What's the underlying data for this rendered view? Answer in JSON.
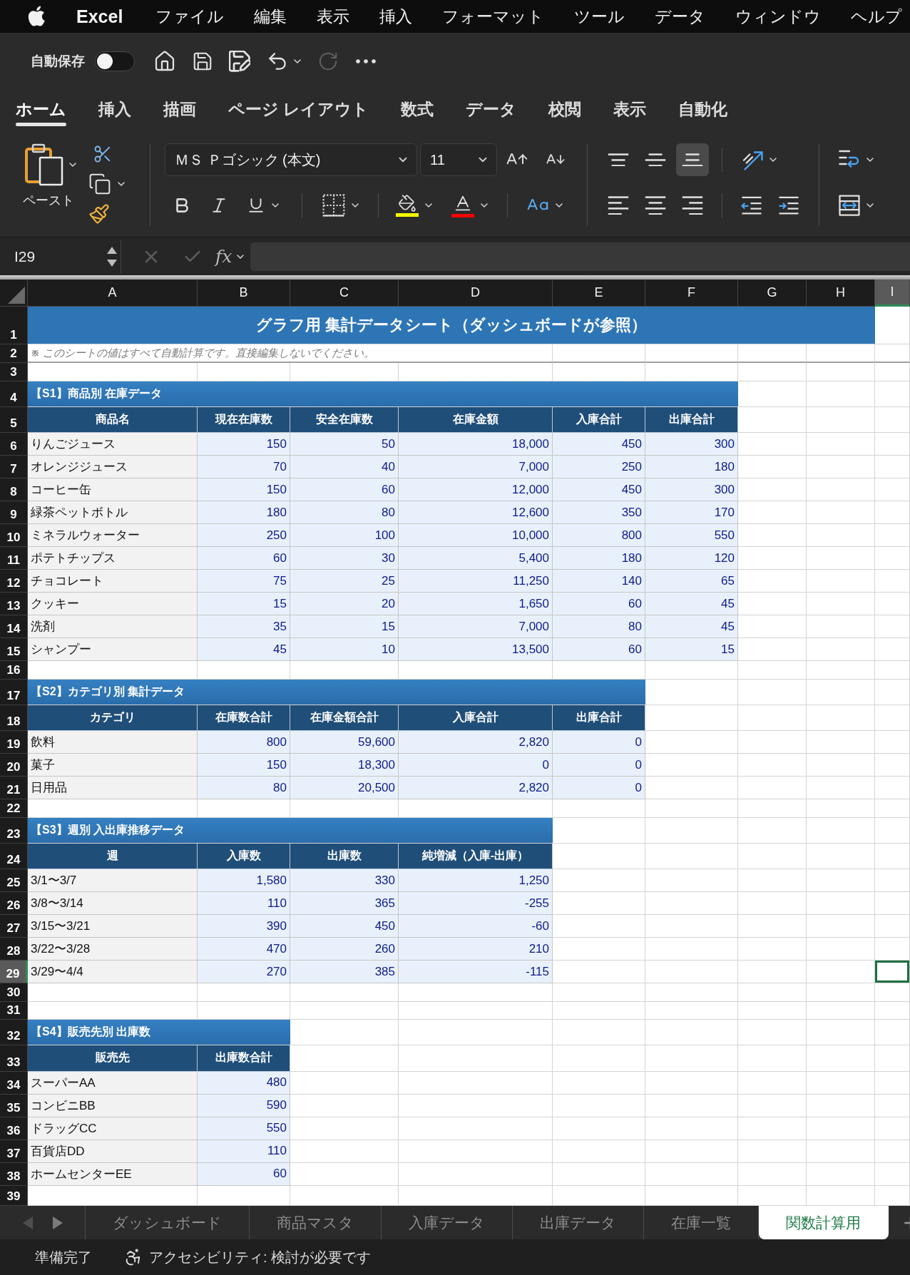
{
  "menu_bar": {
    "app_name": "Excel",
    "items": [
      "ファイル",
      "編集",
      "表示",
      "挿入",
      "フォーマット",
      "ツール",
      "データ",
      "ウィンドウ",
      "ヘルプ"
    ]
  },
  "quick_access": {
    "autosave_label": "自動保存",
    "autosave_on": false,
    "redo_disabled": true
  },
  "ribbon_tabs": [
    {
      "label": "ホーム",
      "selected": true
    },
    {
      "label": "挿入",
      "selected": false
    },
    {
      "label": "描画",
      "selected": false
    },
    {
      "label": "ページ レイアウト",
      "selected": false
    },
    {
      "label": "数式",
      "selected": false
    },
    {
      "label": "データ",
      "selected": false
    },
    {
      "label": "校閲",
      "selected": false
    },
    {
      "label": "表示",
      "selected": false
    },
    {
      "label": "自動化",
      "selected": false
    }
  ],
  "ribbon": {
    "paste_label": "ペースト",
    "font_name": "ＭＳ Ｐゴシック (本文)",
    "font_size": "11",
    "vertical_align": [
      {
        "kind": "top",
        "selected": false
      },
      {
        "kind": "middle",
        "selected": false
      },
      {
        "kind": "bottom",
        "selected": true
      }
    ]
  },
  "formula_bar": {
    "name_box": "I29",
    "function_label": "fx"
  },
  "column_headers": [
    {
      "label": "A",
      "selected": false
    },
    {
      "label": "B",
      "selected": false
    },
    {
      "label": "C",
      "selected": false
    },
    {
      "label": "D",
      "selected": false
    },
    {
      "label": "E",
      "selected": false
    },
    {
      "label": "F",
      "selected": false
    },
    {
      "label": "G",
      "selected": false
    },
    {
      "label": "H",
      "selected": false
    },
    {
      "label": "I",
      "selected": true
    }
  ],
  "rows": [
    {
      "label": "1",
      "selected": false,
      "kind": "title",
      "text": "グラフ用 集計データシート（ダッシュボードが参照）"
    },
    {
      "label": "2",
      "selected": false,
      "kind": "note",
      "text": "※ このシートの値はすべて自動計算です。直接編集しないでください。"
    },
    {
      "label": "3",
      "selected": false,
      "kind": "empty"
    },
    {
      "label": "4",
      "selected": false,
      "kind": "section",
      "text": "【S1】商品別 在庫データ"
    },
    {
      "label": "5",
      "selected": false,
      "kind": "header",
      "cells": [
        "商品名",
        "現在在庫数",
        "安全在庫数",
        "在庫金額",
        "入庫合計",
        "出庫合計"
      ]
    },
    {
      "label": "6",
      "selected": false,
      "kind": "data",
      "cells": [
        "りんごジュース",
        "150",
        "50",
        "18,000",
        "450",
        "300"
      ]
    },
    {
      "label": "7",
      "selected": false,
      "kind": "data",
      "cells": [
        "オレンジジュース",
        "70",
        "40",
        "7,000",
        "250",
        "180"
      ]
    },
    {
      "label": "8",
      "selected": false,
      "kind": "data",
      "cells": [
        "コーヒー缶",
        "150",
        "60",
        "12,000",
        "450",
        "300"
      ]
    },
    {
      "label": "9",
      "selected": false,
      "kind": "data",
      "cells": [
        "緑茶ペットボトル",
        "180",
        "80",
        "12,600",
        "350",
        "170"
      ]
    },
    {
      "label": "10",
      "selected": false,
      "kind": "data",
      "cells": [
        "ミネラルウォーター",
        "250",
        "100",
        "10,000",
        "800",
        "550"
      ]
    },
    {
      "label": "11",
      "selected": false,
      "kind": "data",
      "cells": [
        "ポテトチップス",
        "60",
        "30",
        "5,400",
        "180",
        "120"
      ]
    },
    {
      "label": "12",
      "selected": false,
      "kind": "data",
      "cells": [
        "チョコレート",
        "75",
        "25",
        "11,250",
        "140",
        "65"
      ]
    },
    {
      "label": "13",
      "selected": false,
      "kind": "data",
      "cells": [
        "クッキー",
        "15",
        "20",
        "1,650",
        "60",
        "45"
      ]
    },
    {
      "label": "14",
      "selected": false,
      "kind": "data",
      "cells": [
        "洗剤",
        "35",
        "15",
        "7,000",
        "80",
        "45"
      ]
    },
    {
      "label": "15",
      "selected": false,
      "kind": "data",
      "cells": [
        "シャンプー",
        "45",
        "10",
        "13,500",
        "60",
        "15"
      ]
    },
    {
      "label": "16",
      "selected": false,
      "kind": "empty"
    },
    {
      "label": "17",
      "selected": false,
      "kind": "section",
      "text": "【S2】カテゴリ別 集計データ"
    },
    {
      "label": "18",
      "selected": false,
      "kind": "header",
      "cells": [
        "カテゴリ",
        "在庫数合計",
        "在庫金額合計",
        "入庫合計",
        "出庫合計"
      ]
    },
    {
      "label": "19",
      "selected": false,
      "kind": "data",
      "cells": [
        "飲料",
        "800",
        "59,600",
        "2,820",
        "0"
      ]
    },
    {
      "label": "20",
      "selected": false,
      "kind": "data",
      "cells": [
        "菓子",
        "150",
        "18,300",
        "0",
        "0"
      ]
    },
    {
      "label": "21",
      "selected": false,
      "kind": "data",
      "cells": [
        "日用品",
        "80",
        "20,500",
        "2,820",
        "0"
      ]
    },
    {
      "label": "22",
      "selected": false,
      "kind": "empty"
    },
    {
      "label": "23",
      "selected": false,
      "kind": "section",
      "text": "【S3】週別 入出庫推移データ"
    },
    {
      "label": "24",
      "selected": false,
      "kind": "header",
      "cells": [
        "週",
        "入庫数",
        "出庫数",
        "純増減（入庫-出庫）"
      ]
    },
    {
      "label": "25",
      "selected": false,
      "kind": "data",
      "cells": [
        "3/1〜3/7",
        "1,580",
        "330",
        "1,250"
      ]
    },
    {
      "label": "26",
      "selected": false,
      "kind": "data",
      "cells": [
        "3/8〜3/14",
        "110",
        "365",
        "-255"
      ]
    },
    {
      "label": "27",
      "selected": false,
      "kind": "data",
      "cells": [
        "3/15〜3/21",
        "390",
        "450",
        "-60"
      ]
    },
    {
      "label": "28",
      "selected": false,
      "kind": "data",
      "cells": [
        "3/22〜3/28",
        "470",
        "260",
        "210"
      ]
    },
    {
      "label": "29",
      "selected": true,
      "kind": "data",
      "cells": [
        "3/29〜4/4",
        "270",
        "385",
        "-115"
      ]
    },
    {
      "label": "30",
      "selected": false,
      "kind": "empty"
    },
    {
      "label": "31",
      "selected": false,
      "kind": "empty"
    },
    {
      "label": "32",
      "selected": false,
      "kind": "section",
      "text": "【S4】販売先別 出庫数"
    },
    {
      "label": "33",
      "selected": false,
      "kind": "header",
      "cells": [
        "販売先",
        "出庫数合計"
      ]
    },
    {
      "label": "34",
      "selected": false,
      "kind": "data",
      "cells": [
        "スーパーAA",
        "480"
      ]
    },
    {
      "label": "35",
      "selected": false,
      "kind": "data",
      "cells": [
        "コンビニBB",
        "590"
      ]
    },
    {
      "label": "36",
      "selected": false,
      "kind": "data",
      "cells": [
        "ドラッグCC",
        "550"
      ]
    },
    {
      "label": "37",
      "selected": false,
      "kind": "data",
      "cells": [
        "百貨店DD",
        "110"
      ]
    },
    {
      "label": "38",
      "selected": false,
      "kind": "data",
      "cells": [
        "ホームセンターEE",
        "60"
      ]
    },
    {
      "label": "39",
      "selected": false,
      "kind": "empty"
    }
  ],
  "sheet_tabs": [
    {
      "label": "ダッシュボード",
      "selected": false
    },
    {
      "label": "商品マスタ",
      "selected": false
    },
    {
      "label": "入庫データ",
      "selected": false
    },
    {
      "label": "出庫データ",
      "selected": false
    },
    {
      "label": "在庫一覧",
      "selected": false
    },
    {
      "label": "関数計算用",
      "selected": true
    }
  ],
  "status_bar": {
    "ready": "準備完了",
    "accessibility": "アクセシビリティ: 検討が必要です"
  }
}
